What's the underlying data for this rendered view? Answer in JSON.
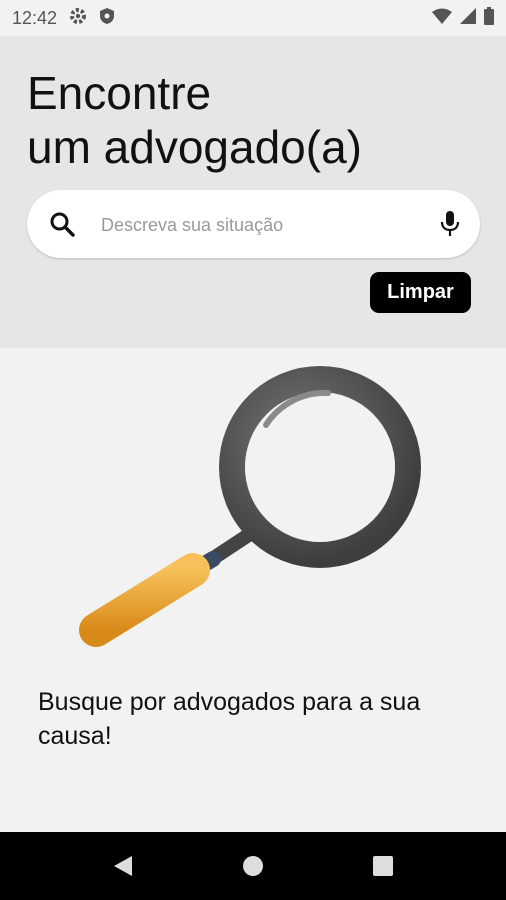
{
  "status_bar": {
    "time": "12:42",
    "icons": [
      "gear-icon",
      "shield-icon",
      "wifi-icon",
      "signal-icon",
      "battery-icon"
    ]
  },
  "header": {
    "title_line1": "Encontre",
    "title_line2": "um advogado(a)"
  },
  "search": {
    "placeholder": "Descreva sua situação",
    "value": "",
    "search_icon": "search-icon",
    "mic_icon": "mic-icon"
  },
  "actions": {
    "clear_label": "Limpar"
  },
  "empty_state": {
    "illustration": "magnifying-glass-illustration",
    "message": "Busque por advogados para a sua causa!"
  },
  "nav_bar": {
    "buttons": [
      "back-icon",
      "home-icon",
      "recents-icon"
    ]
  },
  "colors": {
    "header_bg": "#e6e6e6",
    "body_bg": "#f2f2f2",
    "button_bg": "#000000",
    "nav_bg": "#000000",
    "lens_frame": "#505050",
    "handle": "#f0a030"
  }
}
